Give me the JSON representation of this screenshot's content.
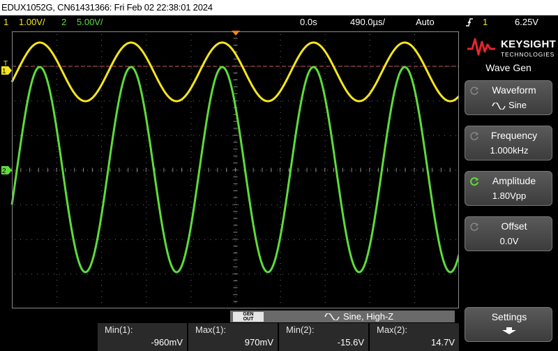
{
  "title_bar": "EDUX1052G, CN61431366: Fri Feb 02 22:38:01 2024",
  "status": {
    "ch1_num": "1",
    "ch1_scale": "1.00V/",
    "ch2_num": "2",
    "ch2_scale": "5.00V/",
    "time_delay": "0.0s",
    "time_scale": "490.0µs/",
    "trigger_mode": "Auto",
    "trigger_slope_icon": "rising-edge-icon",
    "trigger_channel": "1",
    "trigger_level": "6.25V"
  },
  "colors": {
    "ch1": "#f5e61c",
    "ch2": "#5ddc3a",
    "trigger_level_line": "#c85a5a",
    "marker": "#ff8a00"
  },
  "channel_markers": {
    "ch1": "1",
    "ch2": "2",
    "trigger": "T"
  },
  "side_panel": {
    "brand_name": "KEYSIGHT",
    "brand_sub": "TECHNOLOGIES",
    "menu_title": "Wave Gen",
    "softkeys": [
      {
        "label": "Waveform",
        "value": "Sine",
        "value_icon": "sine-wave-icon"
      },
      {
        "label": "Frequency",
        "value": "1.000kHz"
      },
      {
        "label": "Amplitude",
        "value": "1.80Vpp",
        "active": true
      },
      {
        "label": "Offset",
        "value": "0.0V"
      },
      {
        "label": "Settings",
        "value_icon": "down-arrow-icon"
      }
    ]
  },
  "bottom_info": {
    "gen_out_line1": "GEN",
    "gen_out_line2": "OUT",
    "wave_text": "Sine, High-Z"
  },
  "measurements": [
    {
      "name": "Min(1):",
      "value": "-960mV"
    },
    {
      "name": "Max(1):",
      "value": "970mV"
    },
    {
      "name": "Min(2):",
      "value": "-15.6V"
    },
    {
      "name": "Max(2):",
      "value": "14.7V"
    }
  ]
}
